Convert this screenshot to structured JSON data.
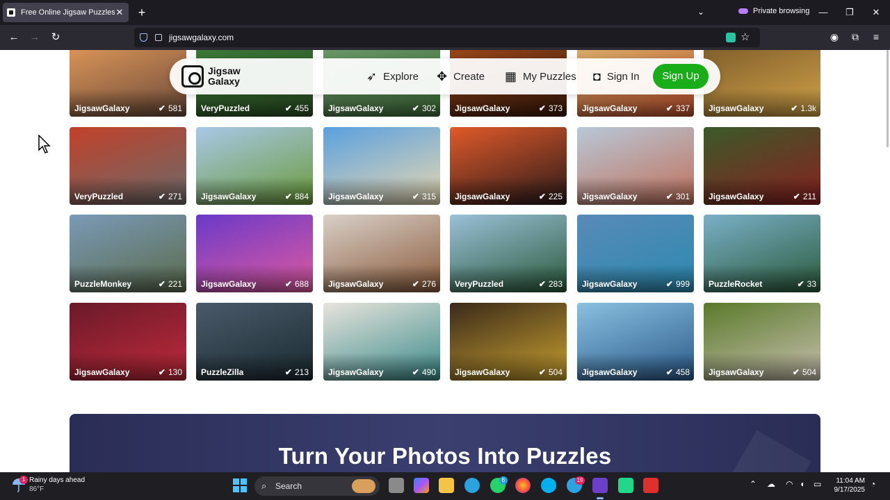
{
  "browser": {
    "tab_title": "Free Online Jigsaw Puzzles for A",
    "tab_close": "✕",
    "new_tab": "+",
    "list_tabs": "⌄",
    "private_label": "Private browsing",
    "minimize": "—",
    "maximize": "❐",
    "close": "✕",
    "back": "←",
    "forward": "→",
    "reload": "↻",
    "url": "jigsawgalaxy.com",
    "bookmark_star": "☆",
    "account": "◉",
    "extensions": "⧉",
    "menu": "≡"
  },
  "site_header": {
    "logo_text": "Jigsaw Galaxy",
    "explore": "Explore",
    "create": "Create",
    "my_puzzles": "My Puzzles",
    "sign_in": "Sign In",
    "sign_up": "Sign Up"
  },
  "puzzles": [
    {
      "author": "JigsawGalaxy",
      "count": "581",
      "colors": [
        "#e39a5a",
        "#6b4a3a"
      ]
    },
    {
      "author": "VeryPuzzled",
      "count": "455",
      "colors": [
        "#3d7d3a",
        "#2a4d22"
      ]
    },
    {
      "author": "JigsawGalaxy",
      "count": "302",
      "colors": [
        "#6d9b6b",
        "#3f6e3a"
      ]
    },
    {
      "author": "JigsawGalaxy",
      "count": "373",
      "colors": [
        "#a14a1c",
        "#3b1a0a"
      ]
    },
    {
      "author": "JigsawGalaxy",
      "count": "337",
      "colors": [
        "#d8b46d",
        "#c04f2e"
      ]
    },
    {
      "author": "JigsawGalaxy",
      "count": "1.3k",
      "colors": [
        "#7b5a2a",
        "#d1a248"
      ]
    },
    {
      "author": "VeryPuzzled",
      "count": "271",
      "colors": [
        "#c2412a",
        "#6a6a6a"
      ]
    },
    {
      "author": "JigsawGalaxy",
      "count": "884",
      "colors": [
        "#a8c8e8",
        "#6b9a3a"
      ]
    },
    {
      "author": "JigsawGalaxy",
      "count": "315",
      "colors": [
        "#5aa0e0",
        "#e8d8b0"
      ]
    },
    {
      "author": "JigsawGalaxy",
      "count": "225",
      "colors": [
        "#e05a2a",
        "#2a1a1a"
      ]
    },
    {
      "author": "JigsawGalaxy",
      "count": "301",
      "colors": [
        "#b8c8d8",
        "#c0705a"
      ]
    },
    {
      "author": "JigsawGalaxy",
      "count": "211",
      "colors": [
        "#3a5a2a",
        "#8a2020"
      ]
    },
    {
      "author": "PuzzleMonkey",
      "count": "221",
      "colors": [
        "#7a9ab8",
        "#5a6a4a"
      ]
    },
    {
      "author": "JigsawGalaxy",
      "count": "688",
      "colors": [
        "#6a3ac8",
        "#e05aa0"
      ]
    },
    {
      "author": "JigsawGalaxy",
      "count": "276",
      "colors": [
        "#d8d0c8",
        "#8a5a3a"
      ]
    },
    {
      "author": "VeryPuzzled",
      "count": "283",
      "colors": [
        "#9ac0d8",
        "#2a5a3a"
      ]
    },
    {
      "author": "JigsawGalaxy",
      "count": "999",
      "colors": [
        "#5a8ab8",
        "#2a8ab0"
      ]
    },
    {
      "author": "PuzzleRocket",
      "count": "33",
      "colors": [
        "#7ab0c8",
        "#2a5a3a"
      ]
    },
    {
      "author": "JigsawGalaxy",
      "count": "130",
      "colors": [
        "#6a1a2a",
        "#c02a3a"
      ]
    },
    {
      "author": "PuzzleZilla",
      "count": "213",
      "colors": [
        "#4a5a6a",
        "#1a2a30"
      ]
    },
    {
      "author": "JigsawGalaxy",
      "count": "490",
      "colors": [
        "#e8e4dc",
        "#3a8a8a"
      ]
    },
    {
      "author": "JigsawGalaxy",
      "count": "504",
      "colors": [
        "#3a2a1a",
        "#c8a030"
      ]
    },
    {
      "author": "JigsawGalaxy",
      "count": "458",
      "colors": [
        "#8ac0e0",
        "#2a5a8a"
      ]
    },
    {
      "author": "JigsawGalaxy",
      "count": "504",
      "colors": [
        "#5a7a2a",
        "#c8c0b0"
      ]
    }
  ],
  "banner": {
    "title": "Turn Your Photos Into Puzzles"
  },
  "taskbar": {
    "weather_badge": "1",
    "weather_title": "Rainy days ahead",
    "weather_temp": "86°F",
    "search_placeholder": "Search",
    "whatsapp_badge": "6",
    "telegram_badge": "19",
    "time": "11:04 AM",
    "date": "9/17/2025"
  }
}
